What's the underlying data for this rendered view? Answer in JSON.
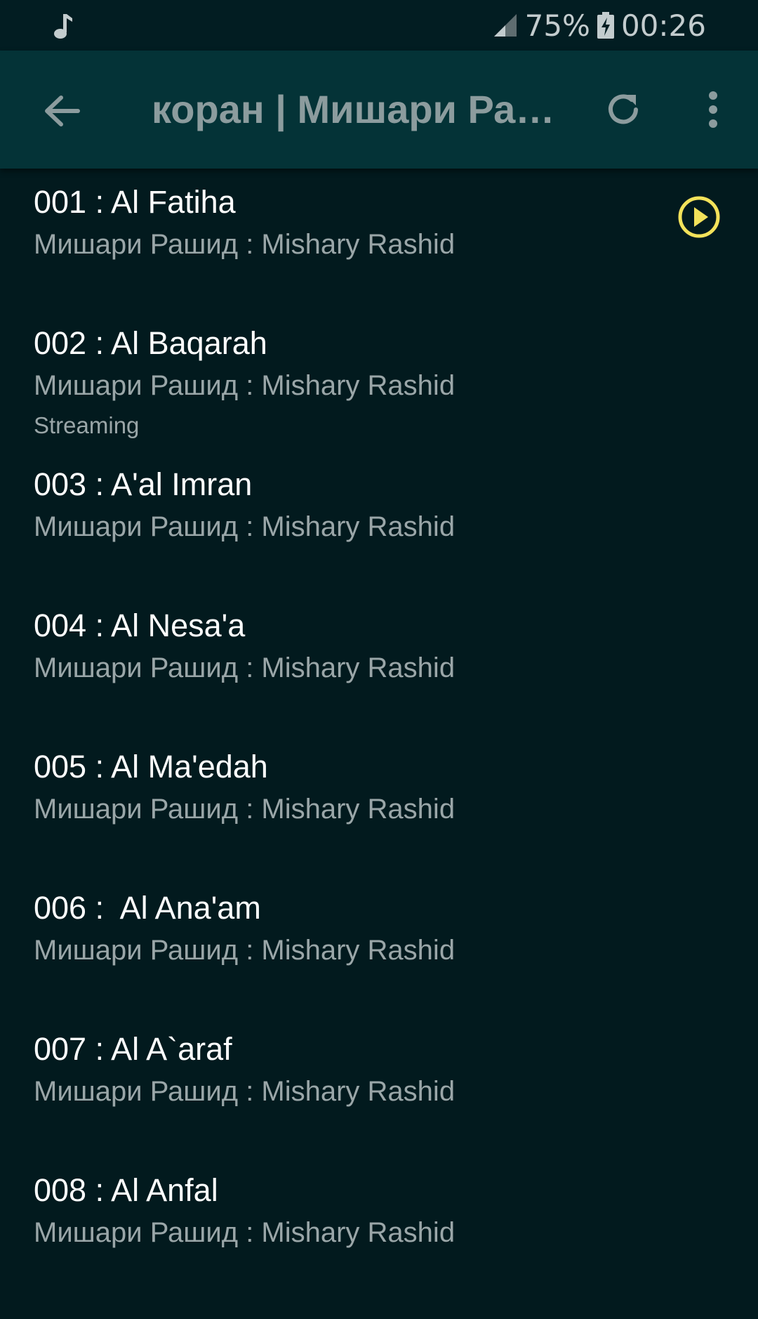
{
  "status_bar": {
    "battery": "75%",
    "time": "00:26",
    "icons": [
      "music-note-icon",
      "signal-icon",
      "battery-charging-icon"
    ]
  },
  "app_bar": {
    "title": "коран | Мишари Рашид",
    "icons": [
      "arrow-back-icon",
      "refresh-icon",
      "more-vert-icon"
    ]
  },
  "tracks": [
    {
      "title": "001 : Al Fatiha",
      "artist": "Мишари Рашид : Mishary Rashid"
    },
    {
      "title": "002 : Al Baqarah",
      "artist": "Мишари Рашид : Mishary Rashid",
      "status": "Streaming"
    },
    {
      "title": "003 : A'al Imran",
      "artist": "Мишари Рашид : Mishary Rashid"
    },
    {
      "title": "004 : Al Nesa'a",
      "artist": "Мишари Рашид : Mishary Rashid"
    },
    {
      "title": "005 : Al Ma'edah",
      "artist": "Мишари Рашид : Mishary Rashid"
    },
    {
      "title": "006 :  Al Ana'am",
      "artist": "Мишари Рашид : Mishary Rashid"
    },
    {
      "title": "007 : Al A`araf",
      "artist": "Мишари Рашид : Mishary Rashid"
    },
    {
      "title": "008 : Al Anfal",
      "artist": "Мишари Рашид : Mishary Rashid"
    }
  ],
  "colors": {
    "background": "#021a1e",
    "app_bar": "#043337",
    "play_accent": "#f3e25a"
  }
}
